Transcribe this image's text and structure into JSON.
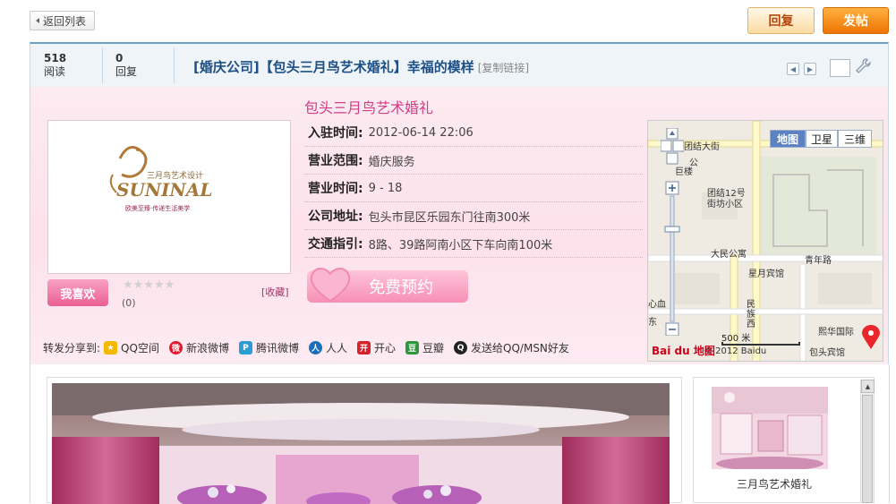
{
  "top": {
    "back_label": "返回列表",
    "reply_label": "回复",
    "post_label": "发帖"
  },
  "header": {
    "views_count": "518",
    "views_label": "阅读",
    "replies_count": "0",
    "replies_label": "回复",
    "title": "[婚庆公司]【包头三月鸟艺术婚礼】幸福的模样",
    "copy_link": "[复制链接]"
  },
  "business": {
    "name": "包头三月鸟艺术婚礼",
    "logo_text_cn": "三月鸟艺术设计",
    "logo_text_en": "SUNINAL",
    "logo_slogan": "欧美至臻·传递生活美学",
    "like_label": "我喜欢",
    "rating_count": "(0)",
    "collect_label": "[收藏]",
    "book_label": "免费预约",
    "info": [
      {
        "key": "入驻时间:",
        "value": "2012-06-14 22:06"
      },
      {
        "key": "营业范围:",
        "value": "婚庆服务"
      },
      {
        "key": "营业时间:",
        "value": "9 - 18"
      },
      {
        "key": "公司地址:",
        "value": "包头市昆区乐园东门往南300米"
      },
      {
        "key": "交通指引:",
        "value": "8路、39路阿南小区下车向南100米"
      }
    ]
  },
  "share": {
    "label": "转发分享到:",
    "items": [
      "QQ空间",
      "新浪微博",
      "腾讯微博",
      "人人",
      "开心",
      "豆瓣",
      "发送给QQ/MSN好友"
    ]
  },
  "map": {
    "types": [
      "地图",
      "卫星",
      "三维"
    ],
    "labels": [
      "团结大街",
      "团结12号",
      "街坊小区",
      "大民公寓",
      "星月宾馆",
      "青年路",
      "熙华国际",
      "包头宾馆",
      "民族西",
      "心血",
      "东",
      "巨楼",
      "公"
    ],
    "scale": "500 米",
    "copyright": "© 2012 Baidu",
    "logo": "Bai du 地图"
  },
  "gallery": {
    "thumb_label": "三月鸟艺术婚礼"
  }
}
